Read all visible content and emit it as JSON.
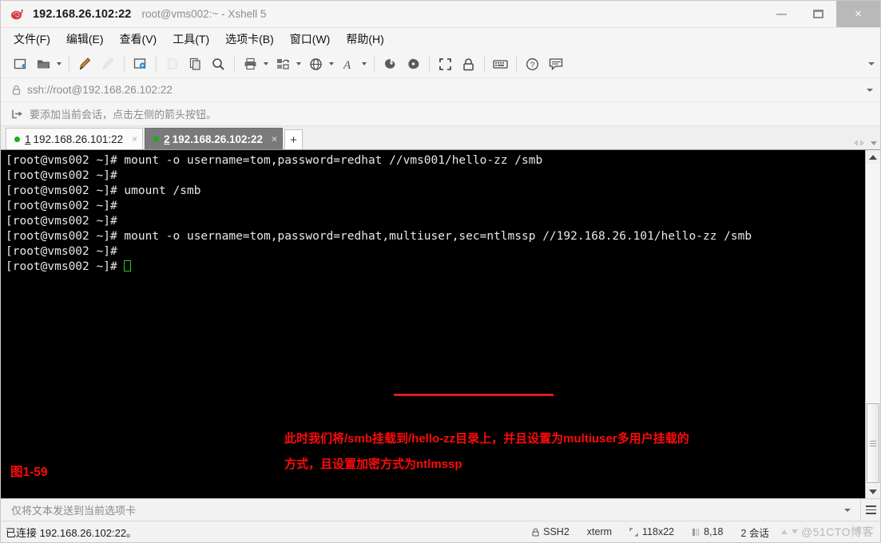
{
  "window": {
    "title": "192.168.26.102:22",
    "subtitle": "root@vms002:~ - Xshell 5",
    "app_icon": "xshell-snail-icon",
    "minimize_label": "–",
    "maximize_label": "□",
    "close_label": "×"
  },
  "menubar": {
    "items": [
      {
        "label": "文件(F)",
        "name": "menu-file"
      },
      {
        "label": "编辑(E)",
        "name": "menu-edit"
      },
      {
        "label": "查看(V)",
        "name": "menu-view"
      },
      {
        "label": "工具(T)",
        "name": "menu-tools"
      },
      {
        "label": "选项卡(B)",
        "name": "menu-tabs"
      },
      {
        "label": "窗口(W)",
        "name": "menu-window"
      },
      {
        "label": "帮助(H)",
        "name": "menu-help"
      }
    ]
  },
  "toolbar": {
    "icons": [
      "new-session-icon",
      "open-folder-icon",
      "connect-icon",
      "disconnect-icon",
      "session-properties-icon",
      "paste-page-icon",
      "copy-icon",
      "find-icon",
      "print-icon",
      "transfer-file-icon",
      "web-icon",
      "font-icon",
      "zmodem-icon",
      "sftp-icon",
      "fullscreen-icon",
      "lock-icon",
      "keyboard-icon",
      "help-icon",
      "comment-icon"
    ],
    "overflow_label": "▾"
  },
  "addressbar": {
    "icon": "lock-icon",
    "value": "ssh://root@192.168.26.102:22",
    "dropdown_label": "▾"
  },
  "hintbar": {
    "icon": "arrow-into-box-icon",
    "text": "要添加当前会话，点击左侧的箭头按钮。"
  },
  "tabs": {
    "items": [
      {
        "num": "1",
        "label": "192.168.26.101:22",
        "active": false,
        "status": "connected"
      },
      {
        "num": "2",
        "label": "192.168.26.102:22",
        "active": true,
        "status": "connected"
      }
    ],
    "add_label": "+",
    "close_label": "×"
  },
  "terminal": {
    "prompt": "[root@vms002 ~]#",
    "lines": [
      "[root@vms002 ~]# mount -o username=tom,password=redhat //vms001/hello-zz /smb",
      "[root@vms002 ~]#",
      "[root@vms002 ~]# umount /smb",
      "[root@vms002 ~]#",
      "[root@vms002 ~]#",
      "[root@vms002 ~]# mount -o username=tom,password=redhat,multiuser,sec=ntlmssp //192.168.26.101/hello-zz /smb",
      "[root@vms002 ~]#"
    ],
    "last_line": "[root@vms002 ~]# ",
    "highlight": "multiuser,sec=ntlmssp",
    "annotation_line1": "此时我们将/smb挂载到/hello-zz目录上，并且设置为multiuser多用户挂载的",
    "annotation_line2": "方式，且设置加密方式为ntlmssp",
    "figure_label": "图1-59",
    "background": "#000000",
    "text_color": "#e8e8e8",
    "annotation_color": "#ff0a0a",
    "cursor_color": "#24d024"
  },
  "sendbar": {
    "text": "仅将文本发送到当前选项卡",
    "dropdown_label": "▾",
    "menu_icon": "hamburger-icon"
  },
  "statusbar": {
    "connection": "已连接 192.168.26.102:22。",
    "protocol": "SSH2",
    "protocol_icon": "lock-icon",
    "terminal_type": "xterm",
    "size": "118x22",
    "size_icon": "resize-icon",
    "cursor_pos": "8,18",
    "cursor_icon": "cursor-icon",
    "sessions": "2 会话",
    "watermark": "@51CTO博客"
  }
}
